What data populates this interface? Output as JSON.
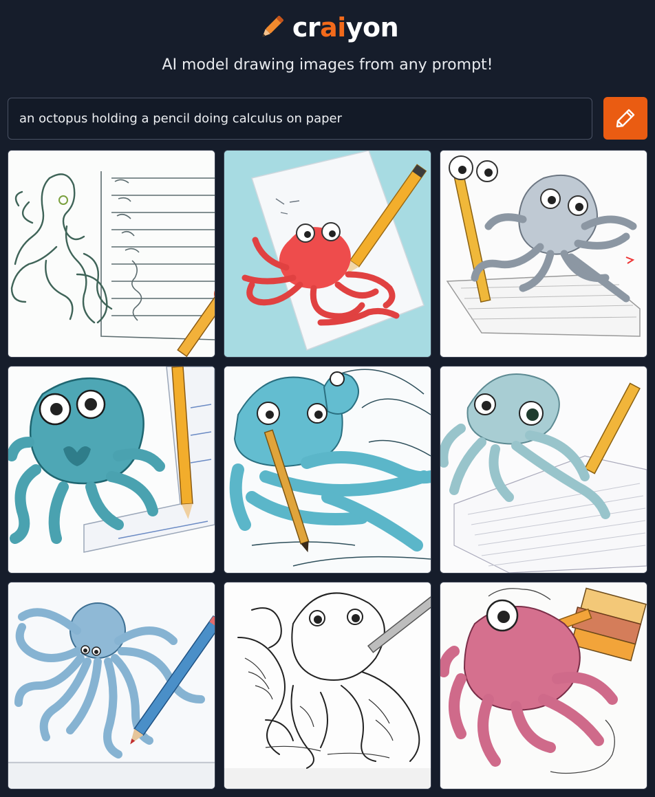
{
  "app": {
    "logo_prefix": "cr",
    "logo_ai": "ai",
    "logo_suffix": "yon",
    "tagline": "AI model drawing images from any prompt!"
  },
  "prompt": {
    "value": "an octopus holding a pencil doing calculus on paper"
  },
  "draw_button": {
    "icon": "pencil-icon"
  },
  "results": {
    "count": 9,
    "images": [
      {
        "subject": "octopus-sketch-lined-paper"
      },
      {
        "subject": "red-octopus-pencil-blue"
      },
      {
        "subject": "gray-octopus-pencil"
      },
      {
        "subject": "teal-octopus-pencil"
      },
      {
        "subject": "blue-octopus-pencil-lines"
      },
      {
        "subject": "teal-octopus-yellow-pencil"
      },
      {
        "subject": "blue-octopus-blue-pencil"
      },
      {
        "subject": "line-art-octopus"
      },
      {
        "subject": "pink-octopus-books"
      }
    ]
  },
  "colors": {
    "background": "#161d2b",
    "accent": "#ea5c12",
    "brand_ai": "#f26a1b"
  }
}
